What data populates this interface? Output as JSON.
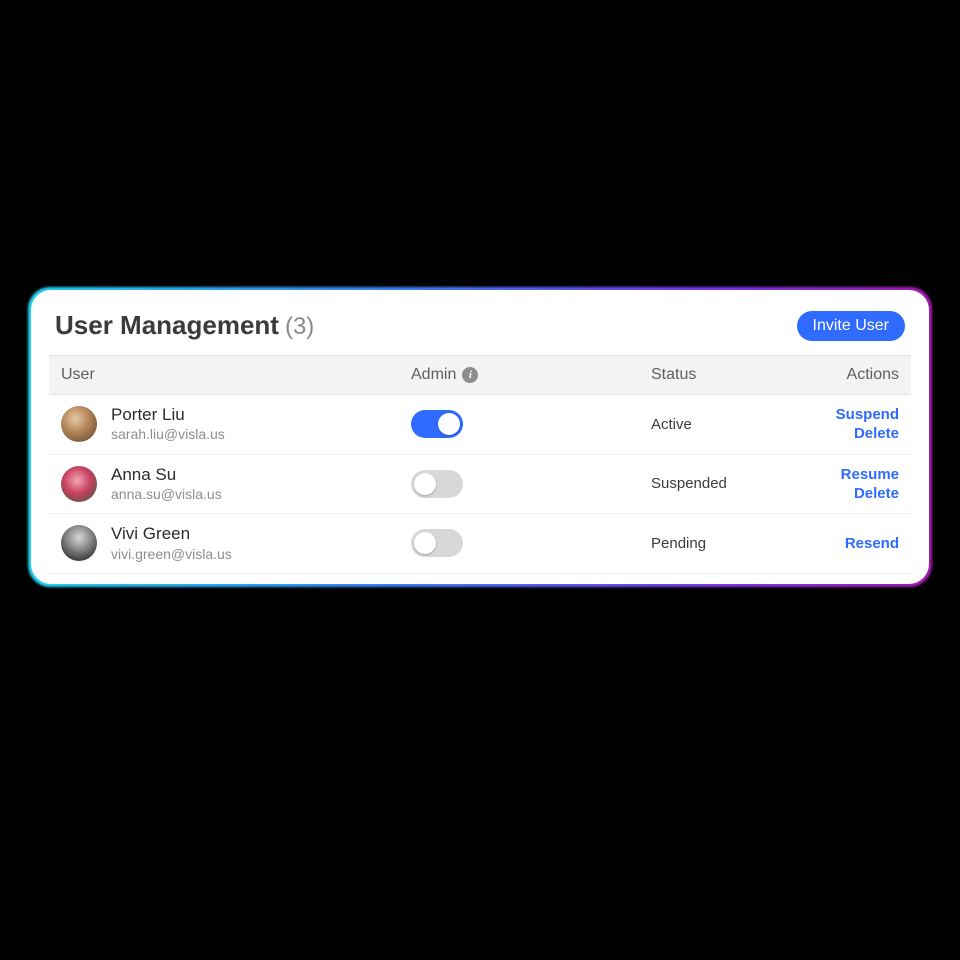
{
  "header": {
    "title": "User Management",
    "count": "(3)",
    "invite_label": "Invite User"
  },
  "columns": {
    "user": "User",
    "admin": "Admin",
    "status": "Status",
    "actions": "Actions"
  },
  "icons": {
    "info": "i"
  },
  "users": [
    {
      "name": "Porter Liu",
      "email": "sarah.liu@visla.us",
      "admin": true,
      "status": "Active",
      "actions": [
        "Suspend",
        "Delete"
      ]
    },
    {
      "name": "Anna Su",
      "email": "anna.su@visla.us",
      "admin": false,
      "status": "Suspended",
      "actions": [
        "Resume",
        "Delete"
      ]
    },
    {
      "name": "Vivi Green",
      "email": "vivi.green@visla.us",
      "admin": false,
      "status": "Pending",
      "actions": [
        "Resend"
      ]
    }
  ]
}
